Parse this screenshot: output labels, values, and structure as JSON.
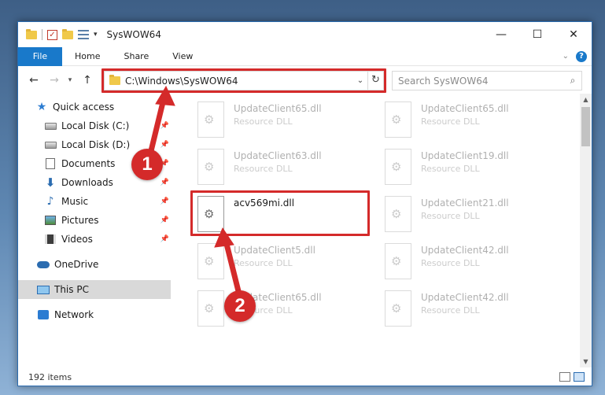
{
  "window": {
    "title": "SysWOW64",
    "controls": {
      "minimize": "—",
      "maximize": "☐",
      "close": "✕"
    }
  },
  "ribbon": {
    "tabs": [
      "File",
      "Home",
      "Share",
      "View"
    ],
    "help": "?"
  },
  "address": {
    "path": "C:\\Windows\\SysWOW64",
    "search_placeholder": "Search SysWOW64"
  },
  "sidebar": {
    "quick_access": "Quick access",
    "items": [
      {
        "label": "Local Disk (C:)",
        "icon": "drive-icon"
      },
      {
        "label": "Local Disk (D:)",
        "icon": "drive-icon"
      },
      {
        "label": "Documents",
        "icon": "documents-icon"
      },
      {
        "label": "Downloads",
        "icon": "download-icon"
      },
      {
        "label": "Music",
        "icon": "music-icon"
      },
      {
        "label": "Pictures",
        "icon": "pictures-icon"
      },
      {
        "label": "Videos",
        "icon": "videos-icon"
      }
    ],
    "onedrive": "OneDrive",
    "this_pc": "This PC",
    "network": "Network"
  },
  "files": [
    {
      "name": "UpdateClient65.dll",
      "desc": "Resource DLL",
      "faded": true
    },
    {
      "name": "UpdateClient65.dll",
      "desc": "Resource DLL",
      "faded": true
    },
    {
      "name": "UpdateClient63.dll",
      "desc": "Resource DLL",
      "faded": true
    },
    {
      "name": "UpdateClient19.dll",
      "desc": "Resource DLL",
      "faded": true
    },
    {
      "name": "acv569mi.dll",
      "desc": "",
      "faded": false
    },
    {
      "name": "UpdateClient21.dll",
      "desc": "Resource DLL",
      "faded": true
    },
    {
      "name": "UpdateClient5.dll",
      "desc": "Resource DLL",
      "faded": true
    },
    {
      "name": "UpdateClient42.dll",
      "desc": "Resource DLL",
      "faded": true
    },
    {
      "name": "UpdateClient65.dll",
      "desc": "Resource DLL",
      "faded": true
    },
    {
      "name": "UpdateClient42.dll",
      "desc": "Resource DLL",
      "faded": true
    }
  ],
  "status": {
    "count": "192 items"
  },
  "callouts": {
    "one": "1",
    "two": "2",
    "color": "#d42a2a"
  }
}
